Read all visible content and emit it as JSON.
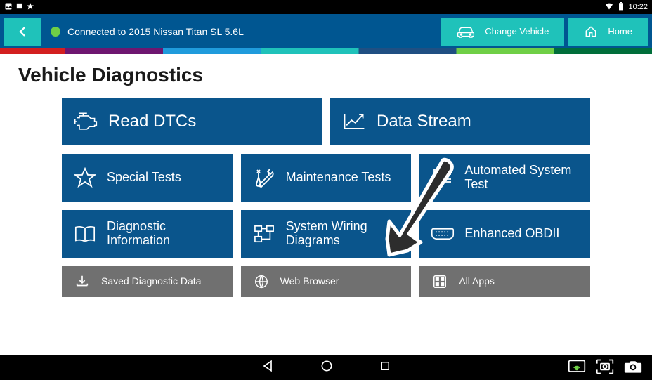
{
  "status": {
    "time": "10:22"
  },
  "header": {
    "connection_text": "Connected to 2015 Nissan Titan SL 5.6L",
    "change_vehicle": "Change Vehicle",
    "home": "Home"
  },
  "page": {
    "title": "Vehicle Diagnostics"
  },
  "tiles": {
    "read_dtcs": "Read DTCs",
    "data_stream": "Data Stream",
    "special_tests": "Special Tests",
    "maintenance_tests": "Maintenance Tests",
    "automated_system_test": "Automated System Test",
    "diagnostic_info": "Diagnostic Information",
    "wiring_diagrams": "System Wiring Diagrams",
    "enhanced_obdii": "Enhanced OBDII",
    "saved_data": "Saved Diagnostic Data",
    "web_browser": "Web Browser",
    "all_apps": "All Apps"
  }
}
